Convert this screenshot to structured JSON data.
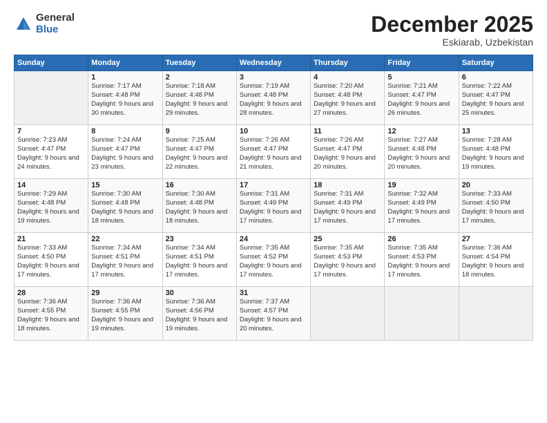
{
  "header": {
    "logo_general": "General",
    "logo_blue": "Blue",
    "main_title": "December 2025",
    "subtitle": "Eskiarab, Uzbekistan"
  },
  "calendar": {
    "days_of_week": [
      "Sunday",
      "Monday",
      "Tuesday",
      "Wednesday",
      "Thursday",
      "Friday",
      "Saturday"
    ],
    "weeks": [
      [
        {
          "day": "",
          "sunrise": "",
          "sunset": "",
          "daylight": "",
          "empty": true
        },
        {
          "day": "1",
          "sunrise": "Sunrise: 7:17 AM",
          "sunset": "Sunset: 4:48 PM",
          "daylight": "Daylight: 9 hours and 30 minutes."
        },
        {
          "day": "2",
          "sunrise": "Sunrise: 7:18 AM",
          "sunset": "Sunset: 4:48 PM",
          "daylight": "Daylight: 9 hours and 29 minutes."
        },
        {
          "day": "3",
          "sunrise": "Sunrise: 7:19 AM",
          "sunset": "Sunset: 4:48 PM",
          "daylight": "Daylight: 9 hours and 28 minutes."
        },
        {
          "day": "4",
          "sunrise": "Sunrise: 7:20 AM",
          "sunset": "Sunset: 4:48 PM",
          "daylight": "Daylight: 9 hours and 27 minutes."
        },
        {
          "day": "5",
          "sunrise": "Sunrise: 7:21 AM",
          "sunset": "Sunset: 4:47 PM",
          "daylight": "Daylight: 9 hours and 26 minutes."
        },
        {
          "day": "6",
          "sunrise": "Sunrise: 7:22 AM",
          "sunset": "Sunset: 4:47 PM",
          "daylight": "Daylight: 9 hours and 25 minutes."
        }
      ],
      [
        {
          "day": "7",
          "sunrise": "Sunrise: 7:23 AM",
          "sunset": "Sunset: 4:47 PM",
          "daylight": "Daylight: 9 hours and 24 minutes."
        },
        {
          "day": "8",
          "sunrise": "Sunrise: 7:24 AM",
          "sunset": "Sunset: 4:47 PM",
          "daylight": "Daylight: 9 hours and 23 minutes."
        },
        {
          "day": "9",
          "sunrise": "Sunrise: 7:25 AM",
          "sunset": "Sunset: 4:47 PM",
          "daylight": "Daylight: 9 hours and 22 minutes."
        },
        {
          "day": "10",
          "sunrise": "Sunrise: 7:26 AM",
          "sunset": "Sunset: 4:47 PM",
          "daylight": "Daylight: 9 hours and 21 minutes."
        },
        {
          "day": "11",
          "sunrise": "Sunrise: 7:26 AM",
          "sunset": "Sunset: 4:47 PM",
          "daylight": "Daylight: 9 hours and 20 minutes."
        },
        {
          "day": "12",
          "sunrise": "Sunrise: 7:27 AM",
          "sunset": "Sunset: 4:48 PM",
          "daylight": "Daylight: 9 hours and 20 minutes."
        },
        {
          "day": "13",
          "sunrise": "Sunrise: 7:28 AM",
          "sunset": "Sunset: 4:48 PM",
          "daylight": "Daylight: 9 hours and 19 minutes."
        }
      ],
      [
        {
          "day": "14",
          "sunrise": "Sunrise: 7:29 AM",
          "sunset": "Sunset: 4:48 PM",
          "daylight": "Daylight: 9 hours and 19 minutes."
        },
        {
          "day": "15",
          "sunrise": "Sunrise: 7:30 AM",
          "sunset": "Sunset: 4:48 PM",
          "daylight": "Daylight: 9 hours and 18 minutes."
        },
        {
          "day": "16",
          "sunrise": "Sunrise: 7:30 AM",
          "sunset": "Sunset: 4:48 PM",
          "daylight": "Daylight: 9 hours and 18 minutes."
        },
        {
          "day": "17",
          "sunrise": "Sunrise: 7:31 AM",
          "sunset": "Sunset: 4:49 PM",
          "daylight": "Daylight: 9 hours and 17 minutes."
        },
        {
          "day": "18",
          "sunrise": "Sunrise: 7:31 AM",
          "sunset": "Sunset: 4:49 PM",
          "daylight": "Daylight: 9 hours and 17 minutes."
        },
        {
          "day": "19",
          "sunrise": "Sunrise: 7:32 AM",
          "sunset": "Sunset: 4:49 PM",
          "daylight": "Daylight: 9 hours and 17 minutes."
        },
        {
          "day": "20",
          "sunrise": "Sunrise: 7:33 AM",
          "sunset": "Sunset: 4:50 PM",
          "daylight": "Daylight: 9 hours and 17 minutes."
        }
      ],
      [
        {
          "day": "21",
          "sunrise": "Sunrise: 7:33 AM",
          "sunset": "Sunset: 4:50 PM",
          "daylight": "Daylight: 9 hours and 17 minutes."
        },
        {
          "day": "22",
          "sunrise": "Sunrise: 7:34 AM",
          "sunset": "Sunset: 4:51 PM",
          "daylight": "Daylight: 9 hours and 17 minutes."
        },
        {
          "day": "23",
          "sunrise": "Sunrise: 7:34 AM",
          "sunset": "Sunset: 4:51 PM",
          "daylight": "Daylight: 9 hours and 17 minutes."
        },
        {
          "day": "24",
          "sunrise": "Sunrise: 7:35 AM",
          "sunset": "Sunset: 4:52 PM",
          "daylight": "Daylight: 9 hours and 17 minutes."
        },
        {
          "day": "25",
          "sunrise": "Sunrise: 7:35 AM",
          "sunset": "Sunset: 4:53 PM",
          "daylight": "Daylight: 9 hours and 17 minutes."
        },
        {
          "day": "26",
          "sunrise": "Sunrise: 7:35 AM",
          "sunset": "Sunset: 4:53 PM",
          "daylight": "Daylight: 9 hours and 17 minutes."
        },
        {
          "day": "27",
          "sunrise": "Sunrise: 7:36 AM",
          "sunset": "Sunset: 4:54 PM",
          "daylight": "Daylight: 9 hours and 18 minutes."
        }
      ],
      [
        {
          "day": "28",
          "sunrise": "Sunrise: 7:36 AM",
          "sunset": "Sunset: 4:55 PM",
          "daylight": "Daylight: 9 hours and 18 minutes."
        },
        {
          "day": "29",
          "sunrise": "Sunrise: 7:36 AM",
          "sunset": "Sunset: 4:55 PM",
          "daylight": "Daylight: 9 hours and 19 minutes."
        },
        {
          "day": "30",
          "sunrise": "Sunrise: 7:36 AM",
          "sunset": "Sunset: 4:56 PM",
          "daylight": "Daylight: 9 hours and 19 minutes."
        },
        {
          "day": "31",
          "sunrise": "Sunrise: 7:37 AM",
          "sunset": "Sunset: 4:57 PM",
          "daylight": "Daylight: 9 hours and 20 minutes."
        },
        {
          "day": "",
          "sunrise": "",
          "sunset": "",
          "daylight": "",
          "empty": true
        },
        {
          "day": "",
          "sunrise": "",
          "sunset": "",
          "daylight": "",
          "empty": true
        },
        {
          "day": "",
          "sunrise": "",
          "sunset": "",
          "daylight": "",
          "empty": true
        }
      ]
    ]
  }
}
